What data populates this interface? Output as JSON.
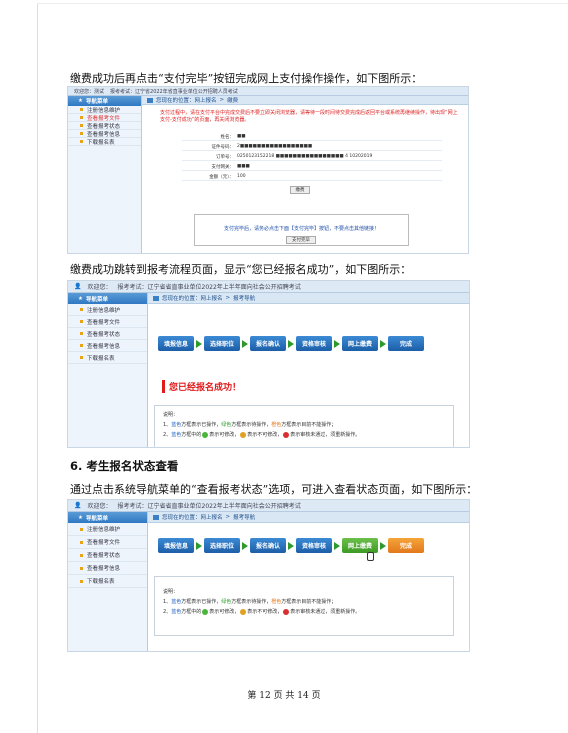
{
  "doc": {
    "para1": "缴费成功后再点击“支付完毕”按钮完成网上支付操作操作，如下图所示：",
    "para2": "缴费成功跳转到报考流程页面，显示“您已经报名成功”，如下图所示：",
    "heading6": "6. 考生报名状态查看",
    "para3": "通过点击系统导航菜单的“查看报考状态”选项，可进入查看状态页面，如下图所示：",
    "footer": "第 12 页 共 14 页"
  },
  "shot1": {
    "topbar": [
      "欢迎您：测试",
      "报考考试：辽宁省2022年省直事业单位公开招聘人员考试"
    ],
    "sidebar_title": "导航菜单",
    "sidebar_items": [
      "注册信息维护",
      "查看报考文件",
      "查看报考状态",
      "查看报考信息",
      "下载报名表"
    ],
    "breadcrumb": [
      "您现在的位置：网上报名",
      ">",
      "缴费"
    ],
    "notice": "支付过程中，请在支付平台中完成交费后不要立即关闭浏览器，请等待一段时间待交费完成后返回平台或系统再继续操作，待出现“网上支付-支付成功”的页面，再关闭浏览器。",
    "form": [
      {
        "label": "姓名：",
        "value": "■■"
      },
      {
        "label": "证件号码：",
        "value": "2■■■■■■■■■■■■■■■■■"
      },
      {
        "label": "订单号：",
        "value": "0250123152218 ■■■■■■■■■■■■■■■■ 4 10202019"
      },
      {
        "label": "支付网关：",
        "value": "■■■"
      },
      {
        "label": "金额（元）：",
        "value": "100"
      }
    ],
    "pay_button": "缴费",
    "prompt": "支付完毕后，请务必点击下面【支付完毕】按钮，不要点击其他链接！",
    "done_button": "支付完毕"
  },
  "shot2": {
    "topbar": [
      "欢迎您：",
      "报考考试：辽宁省省直事业单位2022年上半年面向社会公开招聘考试"
    ],
    "sidebar_title": "导航菜单",
    "sidebar_items": [
      "注册信息维护",
      "查看报考文件",
      "查看报考状态",
      "查看报考信息",
      "下载报名表"
    ],
    "breadcrumb": [
      "您现在的位置：网上报名",
      ">",
      "报考导航"
    ],
    "steps": [
      "填报信息",
      "选择职位",
      "报名确认",
      "资格审核",
      "网上缴费",
      "完成"
    ],
    "success": "您已经报名成功！",
    "legend_title": "说明：",
    "legend_line1": [
      "1、",
      "蓝色",
      "方框表示已操作，",
      "绿色",
      "方框表示待操作，",
      "橙色",
      "方框表示目前不能操作；"
    ],
    "legend_line2": [
      "2、",
      "蓝色",
      "方框中的",
      "表示可修改，",
      "表示不可修改，",
      "表示审核未通过，须重新操作。"
    ]
  },
  "shot3": {
    "topbar": [
      "欢迎您：",
      "报考考试：辽宁省省直事业单位2022年上半年面向社会公开招聘考试"
    ],
    "sidebar_title": "导航菜单",
    "sidebar_items": [
      "注册信息维护",
      "查看报考文件",
      "查看报考状态",
      "查看报考信息",
      "下载报名表"
    ],
    "breadcrumb": [
      "您现在的位置：网上报名",
      ">",
      "报考导航"
    ],
    "steps": [
      "填报信息",
      "选择职位",
      "报名确认",
      "资格审核",
      "网上缴费",
      "完成"
    ],
    "legend_title": "说明：",
    "legend_line1": [
      "1、",
      "蓝色",
      "方框表示已操作，",
      "绿色",
      "方框表示待操作，",
      "橙色",
      "方框表示目前不能操作；"
    ],
    "legend_line2": [
      "2、",
      "蓝色",
      "方框中的",
      "表示可修改，",
      "表示不可修改，",
      "表示审核未通过，须重新操作。"
    ]
  },
  "colors": {
    "accent": "#2f78c2",
    "success": "#e21a1a",
    "step_done": "#1c5ea8",
    "step_todo": "#3d9a24",
    "step_locked": "#e2781a"
  }
}
